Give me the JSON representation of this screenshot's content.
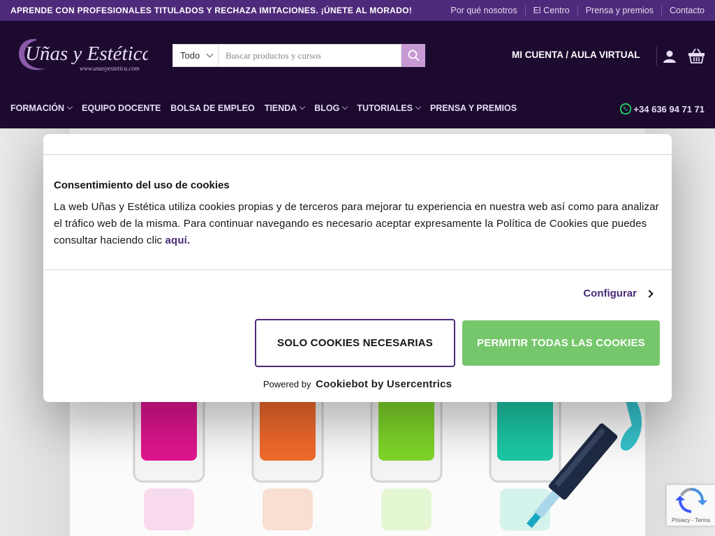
{
  "topbar": {
    "promo": "APRENDE CON PROFESIONALES TITULADOS Y RECHAZA IMITACIONES. ¡ÚNETE AL MORADO!",
    "links": [
      "Por qué nosotros",
      "El Centro",
      "Prensa y premios",
      "Contacto"
    ]
  },
  "header": {
    "logo_text": "Uñas y Estética",
    "logo_url_text": "www.unasyestetica.com",
    "search_category": "Todo",
    "search_placeholder": "Buscar productos y cursos",
    "account_label": "MI CUENTA / AULA VIRTUAL",
    "phone": "+34 636 94 71 71"
  },
  "nav": {
    "items": [
      {
        "label": "FORMACIÓN",
        "has_dropdown": true
      },
      {
        "label": "EQUIPO DOCENTE",
        "has_dropdown": false
      },
      {
        "label": "BOLSA DE EMPLEO",
        "has_dropdown": false
      },
      {
        "label": "TIENDA",
        "has_dropdown": true
      },
      {
        "label": "BLOG",
        "has_dropdown": true
      },
      {
        "label": "TUTORIALES",
        "has_dropdown": true
      },
      {
        "label": "PRENSA Y PREMIOS",
        "has_dropdown": false
      }
    ]
  },
  "cookie_dialog": {
    "title": "Consentimiento del uso de cookies",
    "body": "La web Uñas y Estética utiliza cookies propias y de terceros para mejorar tu experiencia en nuestra web así como para analizar el tráfico web de la misma.  Para continuar navegando es necesario aceptar expresamente la Política de Cookies que puedes consultar haciendo clic ",
    "link_text": "aquí.",
    "configure_label": "Configurar",
    "necessary_button": "SOLO COOKIES NECESARIAS",
    "allow_all_button": "PERMITIR TODAS LAS COOKIES",
    "powered_by": "Powered by",
    "brand": "Cookiebot by Usercentrics"
  },
  "recaptcha": {
    "footer": "Privacy - Terms"
  },
  "colors": {
    "topbar": "#4e2a7a",
    "header": "#1c0b2f",
    "accent_purple": "#4a2a78",
    "search_button": "#c79ad4",
    "allow_button": "#76c76c"
  },
  "icons": [
    "search-icon",
    "user-icon",
    "basket-icon",
    "whatsapp-icon",
    "chevron-right-icon",
    "recaptcha-logo-icon"
  ]
}
